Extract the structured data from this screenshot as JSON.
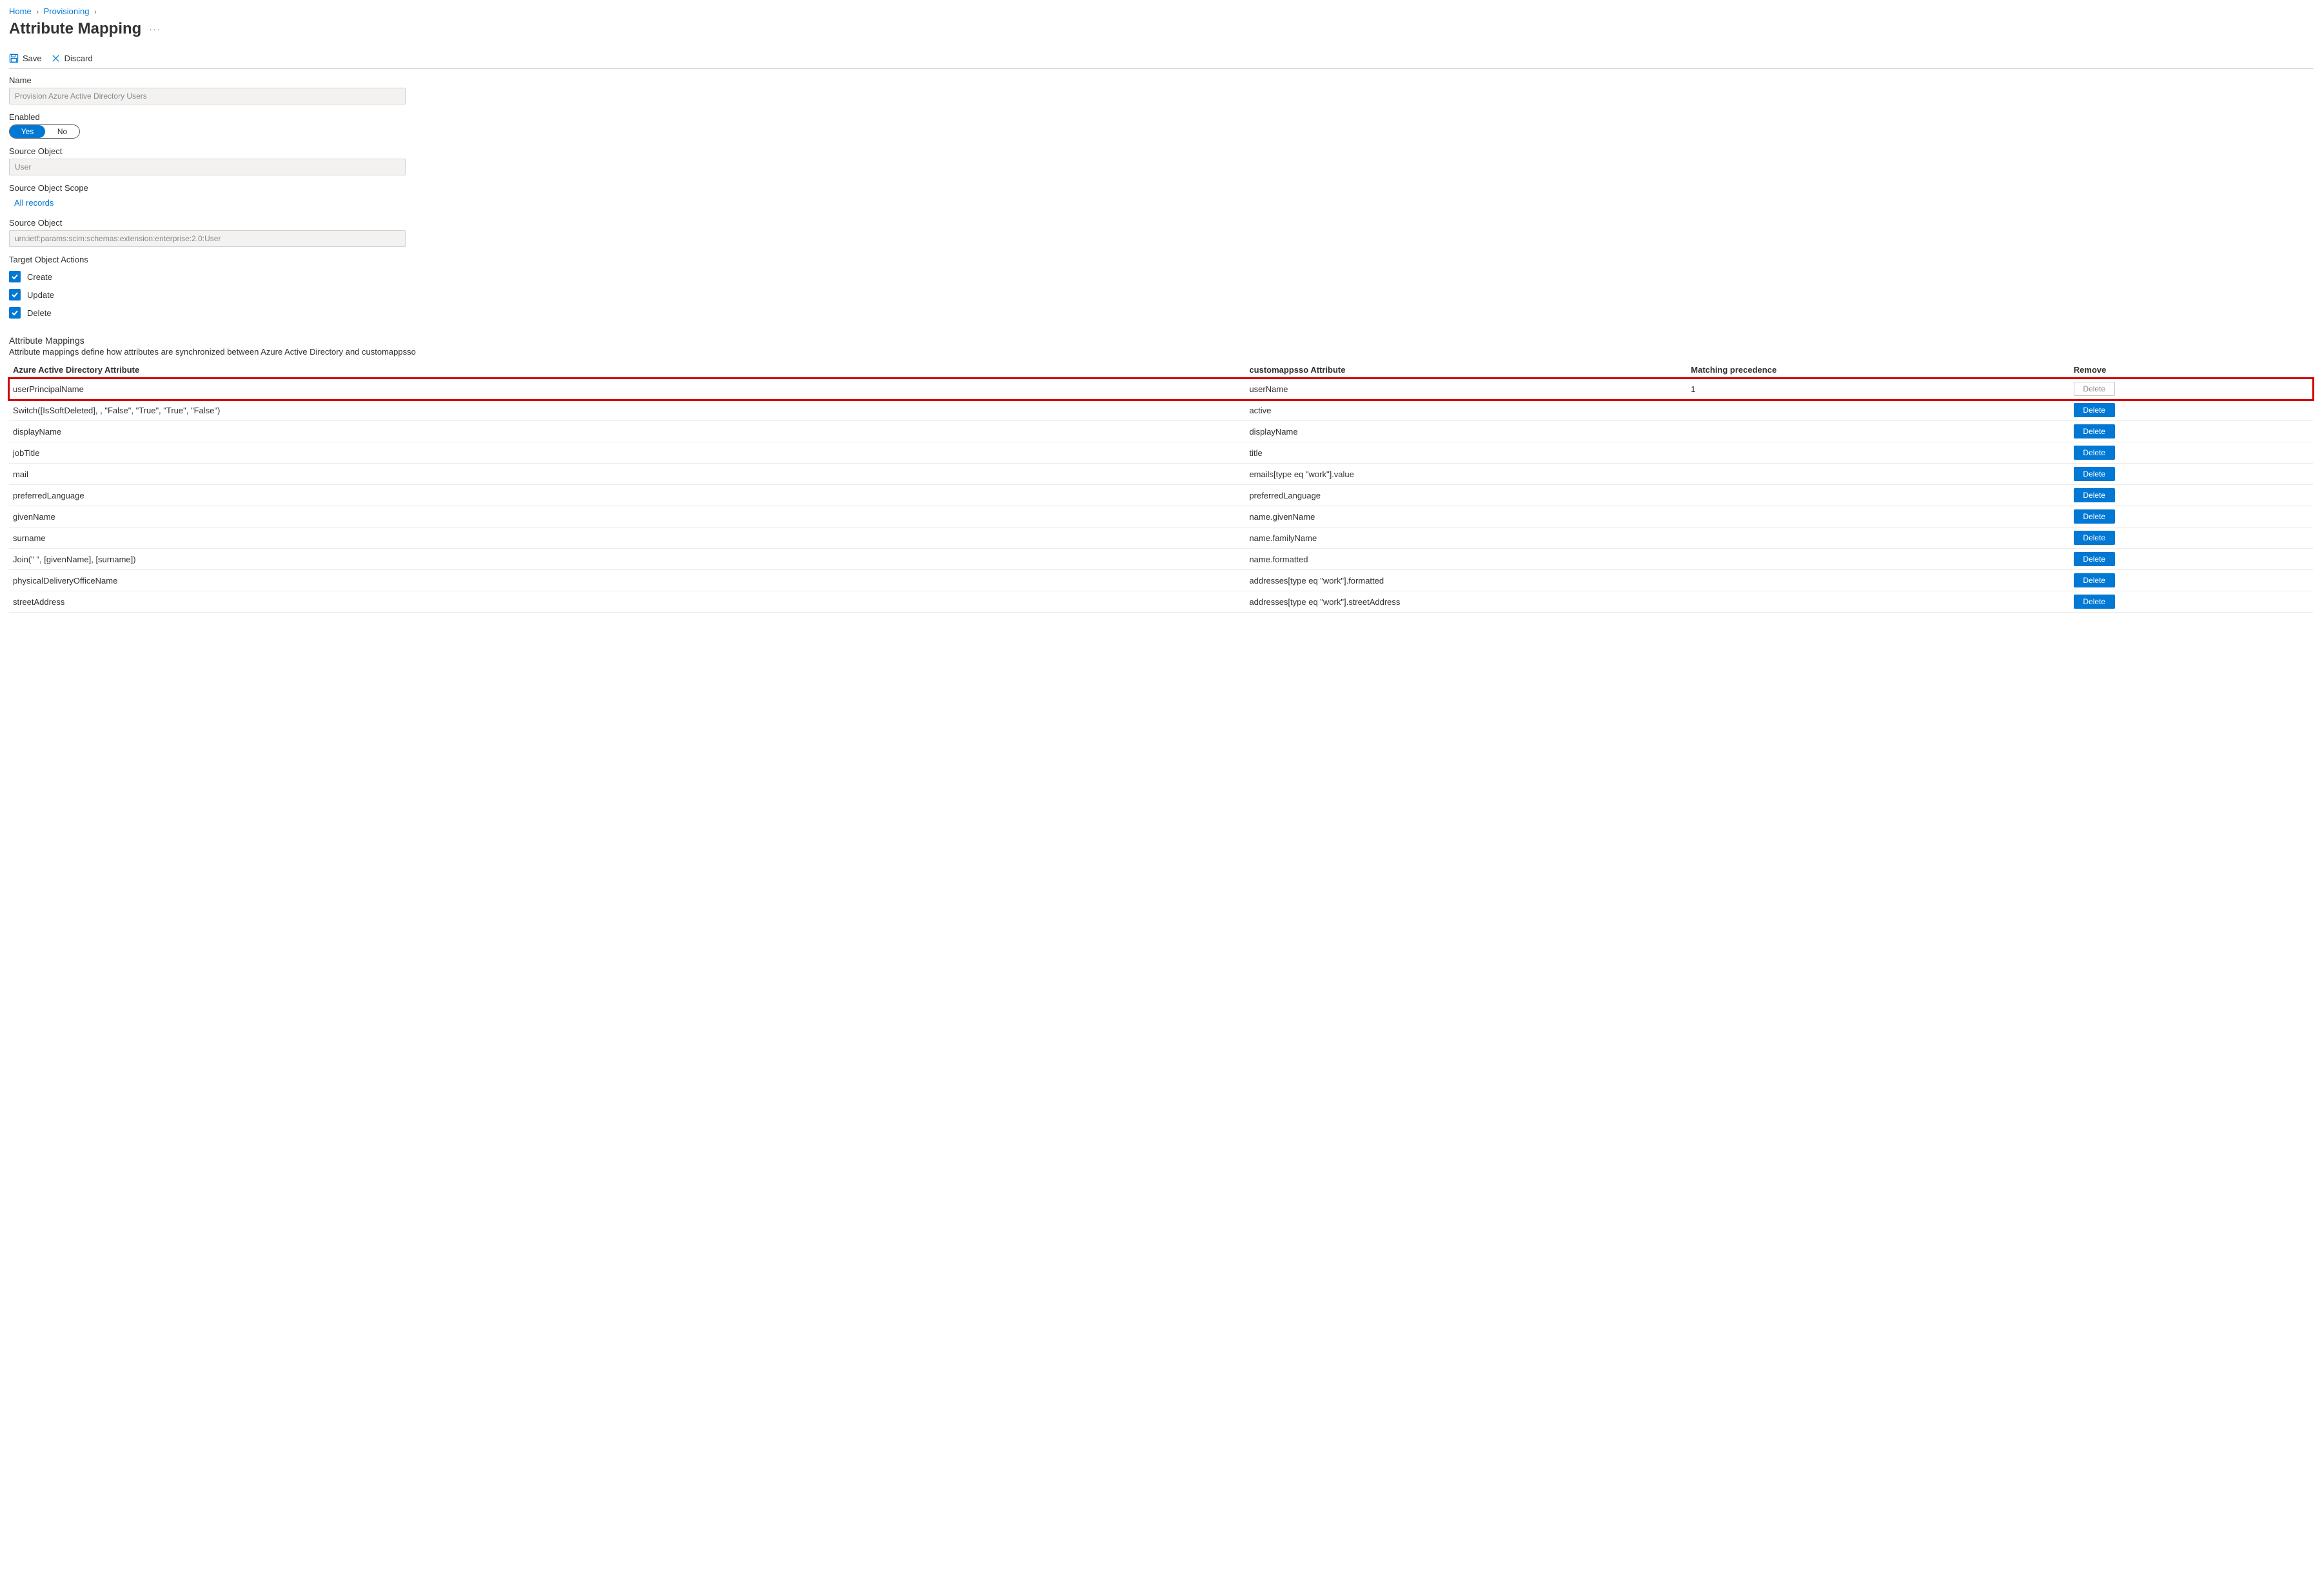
{
  "breadcrumb": {
    "home": "Home",
    "provisioning": "Provisioning"
  },
  "page_title": "Attribute Mapping",
  "toolbar": {
    "save": "Save",
    "discard": "Discard"
  },
  "form": {
    "name_label": "Name",
    "name_value": "Provision Azure Active Directory Users",
    "enabled_label": "Enabled",
    "enabled_yes": "Yes",
    "enabled_no": "No",
    "source_object_label": "Source Object",
    "source_object_value": "User",
    "scope_label": "Source Object Scope",
    "scope_value": "All records",
    "source_object2_label": "Source Object",
    "source_object2_value": "urn:ietf:params:scim:schemas:extension:enterprise:2.0:User",
    "target_actions_label": "Target Object Actions",
    "actions": {
      "create": "Create",
      "update": "Update",
      "delete": "Delete"
    }
  },
  "mappings": {
    "title": "Attribute Mappings",
    "subtitle": "Attribute mappings define how attributes are synchronized between Azure Active Directory and customappsso",
    "columns": {
      "aad": "Azure Active Directory Attribute",
      "custom": "customappsso Attribute",
      "match": "Matching precedence",
      "remove": "Remove"
    },
    "delete_label": "Delete",
    "rows": [
      {
        "aad": "userPrincipalName",
        "custom": "userName",
        "match": "1",
        "disabled": true,
        "highlight": true
      },
      {
        "aad": "Switch([IsSoftDeleted], , \"False\", \"True\", \"True\", \"False\")",
        "custom": "active",
        "match": ""
      },
      {
        "aad": "displayName",
        "custom": "displayName",
        "match": ""
      },
      {
        "aad": "jobTitle",
        "custom": "title",
        "match": ""
      },
      {
        "aad": "mail",
        "custom": "emails[type eq \"work\"].value",
        "match": ""
      },
      {
        "aad": "preferredLanguage",
        "custom": "preferredLanguage",
        "match": ""
      },
      {
        "aad": "givenName",
        "custom": "name.givenName",
        "match": ""
      },
      {
        "aad": "surname",
        "custom": "name.familyName",
        "match": ""
      },
      {
        "aad": "Join(\" \", [givenName], [surname])",
        "custom": "name.formatted",
        "match": ""
      },
      {
        "aad": "physicalDeliveryOfficeName",
        "custom": "addresses[type eq \"work\"].formatted",
        "match": ""
      },
      {
        "aad": "streetAddress",
        "custom": "addresses[type eq \"work\"].streetAddress",
        "match": ""
      }
    ]
  }
}
